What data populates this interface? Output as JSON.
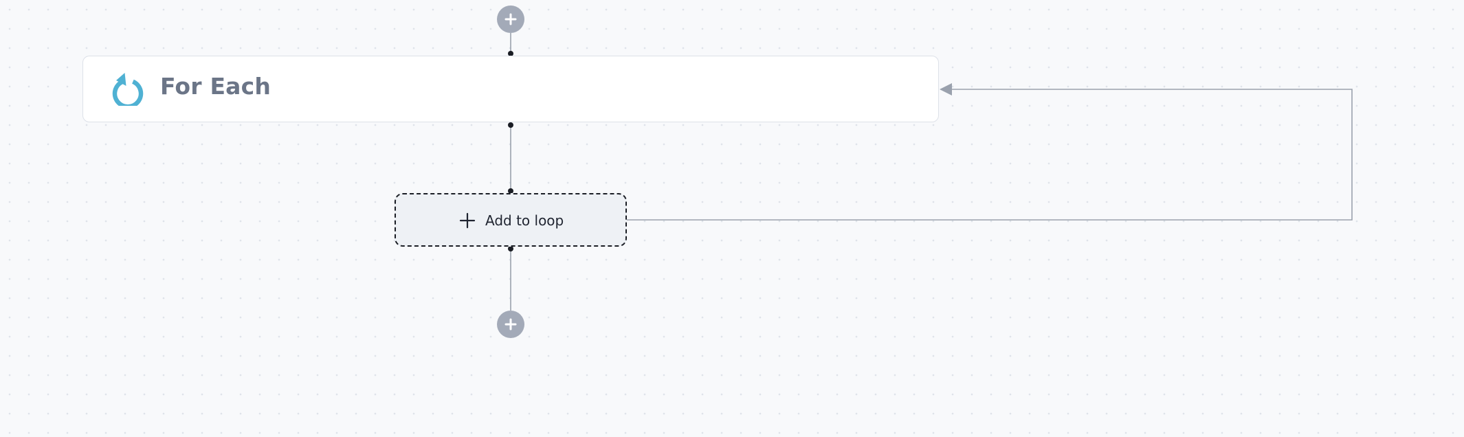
{
  "workflow": {
    "foreach_node": {
      "title": "For Each",
      "icon": "loop-refresh-icon",
      "icon_color": "#4fb1d3"
    },
    "loop_body": {
      "label": "Add to loop",
      "icon": "plus-icon"
    },
    "add_step_icon": "plus-icon",
    "add_step_color": "#a3aab8",
    "edge_color": "#9aa1ad",
    "canvas_background": "#f8f9fb"
  }
}
